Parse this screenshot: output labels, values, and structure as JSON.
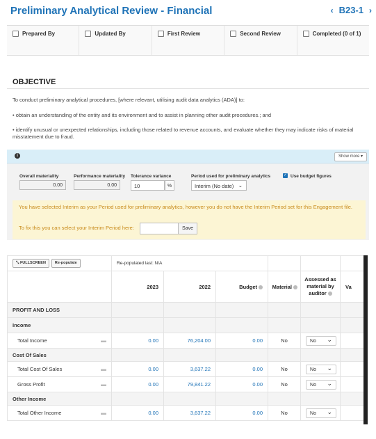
{
  "header": {
    "title": "Preliminary Analytical Review - Financial",
    "code": "B23-1",
    "prev_icon": "chevron-left",
    "next_icon": "chevron-right"
  },
  "signoffs": [
    "Prepared By",
    "Updated By",
    "First Review",
    "Second Review",
    "Completed (0 of 1)"
  ],
  "objective": {
    "heading": "OBJECTIVE",
    "intro": "To conduct preliminary analytical procedures, [where relevant, utilising audit data analytics (ADA)] to:",
    "bullet1": "• obtain an understanding of the entity and its environment and to assist in planning other audit procedures.; and",
    "bullet2": "• identify unusual or unexpected relationships, including those related to revenue accounts, and evaluate whether they may indicate risks of material misstatement due to fraud."
  },
  "infobar": {
    "icon": "info-icon",
    "show_more": "Show more"
  },
  "params": {
    "overall_label": "Overall materiality",
    "overall_value": "0.00",
    "performance_label": "Performance materiality",
    "performance_value": "0.00",
    "tolerance_label": "Tolerance variance",
    "tolerance_value": "10",
    "tolerance_unit": "%",
    "period_label": "Period used for preliminary analytics",
    "period_value": "Interim (No date)",
    "budget_label": "Use budget figures"
  },
  "warning": {
    "text": "You have selected Interim as your Period used for preliminary analytics, however you do not have the Interim Period set for this Engagement file.",
    "fix_text": "To fix this you can select your Interim Period here:",
    "save": "Save"
  },
  "table": {
    "fullscreen": "FULLSCREEN",
    "repopulate": "Re-populate",
    "repopulated": "Re-populated last: N/A",
    "headers": [
      "2023",
      "2022",
      "Budget",
      "Material",
      "Assessed as material by auditor",
      "Va"
    ],
    "section": "PROFIT AND LOSS",
    "rows": [
      {
        "type": "group",
        "label": "Income"
      },
      {
        "type": "data",
        "label": "Total Income",
        "y2023": "0.00",
        "y2022": "76,204.00",
        "budget": "0.00",
        "material": "No",
        "assessed": "No"
      },
      {
        "type": "group",
        "label": "Cost Of Sales"
      },
      {
        "type": "data",
        "label": "Total Cost Of Sales",
        "y2023": "0.00",
        "y2022": "3,637.22",
        "budget": "0.00",
        "material": "No",
        "assessed": "No"
      },
      {
        "type": "data",
        "label": "Gross Profit",
        "y2023": "0.00",
        "y2022": "79,841.22",
        "budget": "0.00",
        "material": "No",
        "assessed": "No"
      },
      {
        "type": "group",
        "label": "Other Income"
      },
      {
        "type": "data",
        "label": "Total Other Income",
        "y2023": "0.00",
        "y2022": "3,637.22",
        "budget": "0.00",
        "material": "No",
        "assessed": "No"
      }
    ]
  }
}
